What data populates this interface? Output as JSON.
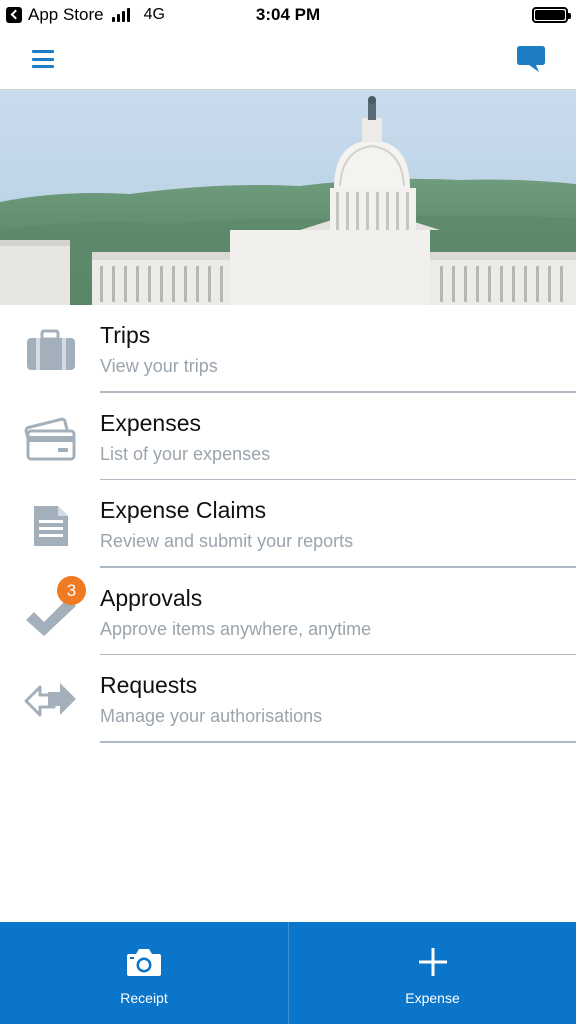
{
  "status_bar": {
    "back_app": "App Store",
    "network": "4G",
    "time": "3:04 PM"
  },
  "nav": {
    "menu_icon": "hamburger-menu-icon",
    "chat_icon": "chat-bubble-icon",
    "accent_color": "#1f7dc4"
  },
  "hero": {
    "subject": "capitol-building-photo"
  },
  "menu": {
    "items": [
      {
        "title": "Trips",
        "subtitle": "View your trips",
        "icon": "briefcase-icon"
      },
      {
        "title": "Expenses",
        "subtitle": "List of your expenses",
        "icon": "credit-card-icon"
      },
      {
        "title": "Expense Claims",
        "subtitle": "Review and submit your reports",
        "icon": "document-icon"
      },
      {
        "title": "Approvals",
        "subtitle": "Approve items anywhere, anytime",
        "icon": "checkmark-icon",
        "badge": "3"
      },
      {
        "title": "Requests",
        "subtitle": "Manage your authorisations",
        "icon": "exchange-arrows-icon"
      }
    ],
    "icon_color": "#a3b0bc",
    "badge_color": "#ef7a22"
  },
  "bottom_bar": {
    "color": "#0a75c9",
    "receipt_label": "Receipt",
    "expense_label": "Expense",
    "receipt_icon": "camera-icon",
    "expense_icon": "plus-icon"
  }
}
